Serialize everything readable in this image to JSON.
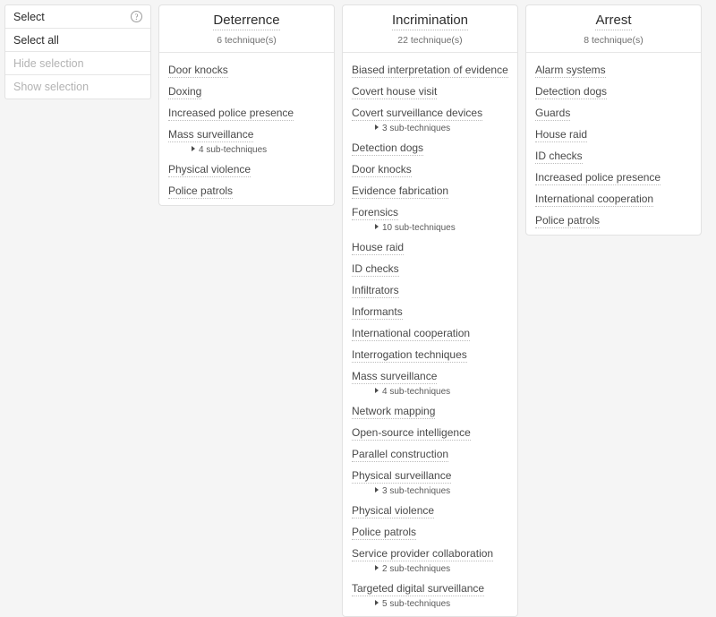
{
  "select_panel": {
    "header_label": "Select",
    "help_icon": "question-mark-circle-icon",
    "items": [
      {
        "label": "Select all",
        "state": "enabled"
      },
      {
        "label": "Hide selection",
        "state": "disabled"
      },
      {
        "label": "Show selection",
        "state": "disabled"
      }
    ]
  },
  "columns": [
    {
      "title": "Deterrence",
      "count_label": "6 technique(s)",
      "techniques": [
        {
          "name": "Door knocks"
        },
        {
          "name": "Doxing"
        },
        {
          "name": "Increased police presence"
        },
        {
          "name": "Mass surveillance",
          "sub_label": "4 sub-techniques"
        },
        {
          "name": "Physical violence"
        },
        {
          "name": "Police patrols"
        }
      ]
    },
    {
      "title": "Incrimination",
      "count_label": "22 technique(s)",
      "techniques": [
        {
          "name": "Biased interpretation of evidence"
        },
        {
          "name": "Covert house visit"
        },
        {
          "name": "Covert surveillance devices",
          "sub_label": "3 sub-techniques"
        },
        {
          "name": "Detection dogs"
        },
        {
          "name": "Door knocks"
        },
        {
          "name": "Evidence fabrication"
        },
        {
          "name": "Forensics",
          "sub_label": "10 sub-techniques"
        },
        {
          "name": "House raid"
        },
        {
          "name": "ID checks"
        },
        {
          "name": "Infiltrators"
        },
        {
          "name": "Informants"
        },
        {
          "name": "International cooperation"
        },
        {
          "name": "Interrogation techniques"
        },
        {
          "name": "Mass surveillance",
          "sub_label": "4 sub-techniques"
        },
        {
          "name": "Network mapping"
        },
        {
          "name": "Open-source intelligence"
        },
        {
          "name": "Parallel construction"
        },
        {
          "name": "Physical surveillance",
          "sub_label": "3 sub-techniques"
        },
        {
          "name": "Physical violence"
        },
        {
          "name": "Police patrols"
        },
        {
          "name": "Service provider collaboration",
          "sub_label": "2 sub-techniques"
        },
        {
          "name": "Targeted digital surveillance",
          "sub_label": "5 sub-techniques"
        }
      ]
    },
    {
      "title": "Arrest",
      "count_label": "8 technique(s)",
      "techniques": [
        {
          "name": "Alarm systems"
        },
        {
          "name": "Detection dogs"
        },
        {
          "name": "Guards"
        },
        {
          "name": "House raid"
        },
        {
          "name": "ID checks"
        },
        {
          "name": "Increased police presence"
        },
        {
          "name": "International cooperation"
        },
        {
          "name": "Police patrols"
        }
      ]
    }
  ],
  "colors": {
    "page_background": "#f5f5f5",
    "card_background": "#ffffff",
    "border": "#e2e2e2",
    "text": "#4a4a4a",
    "muted_text": "#b3b3b3"
  }
}
